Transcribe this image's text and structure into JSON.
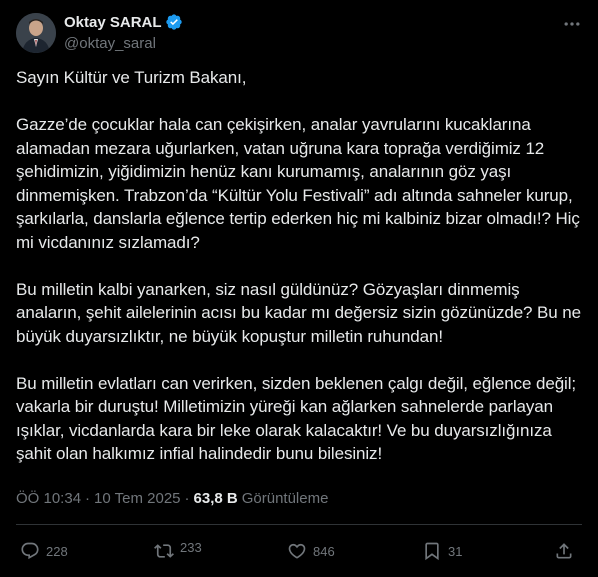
{
  "author": {
    "display_name": "Oktay SARAL",
    "handle": "@oktay_saral",
    "verified": true
  },
  "icons": {
    "verified": "verified-badge-icon",
    "more": "more-options-icon",
    "reply": "reply-icon",
    "retweet": "retweet-icon",
    "like": "heart-icon",
    "bookmark": "bookmark-icon",
    "share": "share-icon"
  },
  "colors": {
    "background": "#000000",
    "text": "#e7e9ea",
    "muted": "#71767b",
    "verified": "#1d9bf0",
    "divider": "#2f3336"
  },
  "tweet": {
    "paragraphs": [
      "Sayın Kültür ve Turizm Bakanı,",
      "Gazze’de çocuklar hala can çekişirken, analar yavrularını kucaklarına alamadan mezara uğurlarken, vatan uğruna kara toprağa verdiğimiz 12 şehidimizin, yiğidimizin henüz kanı kurumamış, analarının göz yaşı dinmemişken. Trabzon’da “Kültür Yolu Festivali” adı altında sahneler kurup, şarkılarla, danslarla eğlence tertip ederken hiç mi kalbiniz bizar olmadı!? Hiç mi vicdanınız sızlamadı?",
      "Bu milletin kalbi yanarken, siz nasıl güldünüz? Gözyaşları dinmemiş anaların, şehit ailelerinin acısı bu kadar mı değersiz sizin gözünüzde? Bu ne büyük duyarsızlıktır, ne büyük kopuştur milletin ruhundan!",
      "Bu milletin evlatları can verirken, sizden beklenen çalgı değil, eğlence değil; vakarla bir duruştu! Milletimizin yüreği kan ağlarken sahnelerde parlayan ışıklar, vicdanlarda kara bir leke olarak kalacaktır! Ve bu duyarsızlığınıza şahit olan halkımız infial halindedir bunu bilesiniz!"
    ]
  },
  "meta": {
    "time": "ÖÖ 10:34",
    "separator": "·",
    "date": "10 Tem 2025",
    "views_count": "63,8 B",
    "views_label": "Görüntüleme"
  },
  "actions": {
    "reply_count": "228",
    "retweet_count": "233",
    "like_count": "846",
    "bookmark_count": "31"
  }
}
